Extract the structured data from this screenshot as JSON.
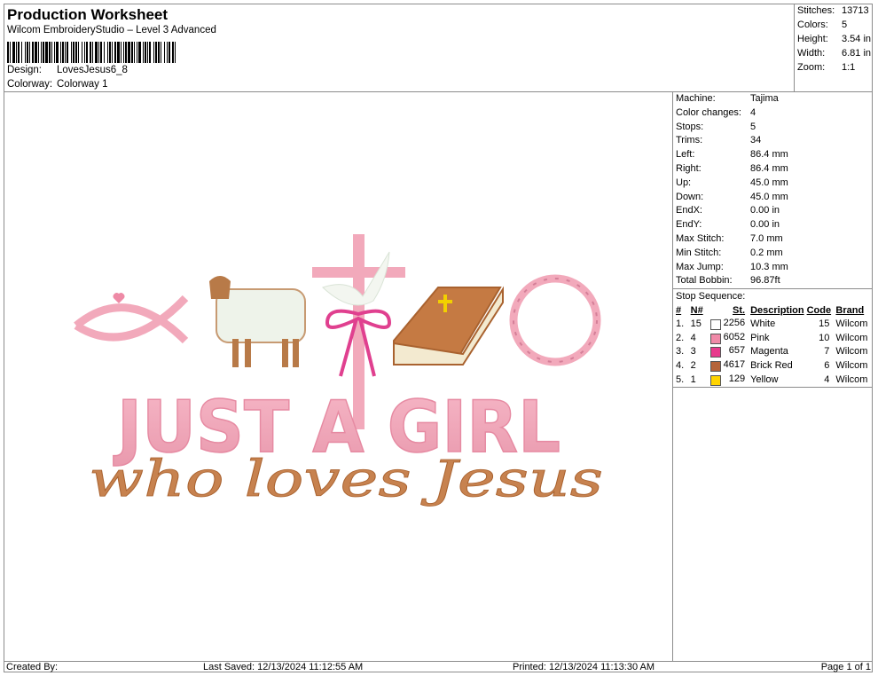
{
  "header": {
    "title": "Production Worksheet",
    "subtitle": "Wilcom EmbroideryStudio – Level 3 Advanced",
    "design_label": "Design:",
    "design_value": "LovesJesus6_8",
    "colorway_label": "Colorway:",
    "colorway_value": "Colorway 1"
  },
  "summary": {
    "stitches_label": "Stitches:",
    "stitches": "13713",
    "colors_label": "Colors:",
    "colors": "5",
    "height_label": "Height:",
    "height": "3.54 in",
    "width_label": "Width:",
    "width": "6.81 in",
    "zoom_label": "Zoom:",
    "zoom": "1:1"
  },
  "stats": [
    {
      "label": "Machine:",
      "value": "Tajima"
    },
    {
      "label": "Color changes:",
      "value": "4"
    },
    {
      "label": "Stops:",
      "value": "5"
    },
    {
      "label": "Trims:",
      "value": "34"
    },
    {
      "label": "Left:",
      "value": "86.4 mm"
    },
    {
      "label": "Right:",
      "value": "86.4 mm"
    },
    {
      "label": "Up:",
      "value": "45.0 mm"
    },
    {
      "label": "Down:",
      "value": "45.0 mm"
    },
    {
      "label": "EndX:",
      "value": "0.00 in"
    },
    {
      "label": "EndY:",
      "value": "0.00 in"
    },
    {
      "label": "Max Stitch:",
      "value": "7.0 mm"
    },
    {
      "label": "Min Stitch:",
      "value": "0.2 mm"
    },
    {
      "label": "Max Jump:",
      "value": "10.3 mm"
    },
    {
      "label": "Total Bobbin:",
      "value": "96.87ft"
    }
  ],
  "stop_sequence": {
    "title": "Stop Sequence:",
    "headers": {
      "num": "#",
      "n": "N#",
      "st": "St.",
      "desc": "Description",
      "code": "Code",
      "brand": "Brand"
    },
    "rows": [
      {
        "num": "1.",
        "n": "15",
        "color": "#ffffff",
        "st": "2256",
        "desc": "White",
        "code": "15",
        "brand": "Wilcom"
      },
      {
        "num": "2.",
        "n": "4",
        "color": "#f08aa8",
        "st": "6052",
        "desc": "Pink",
        "code": "10",
        "brand": "Wilcom"
      },
      {
        "num": "3.",
        "n": "3",
        "color": "#e83a8c",
        "st": "657",
        "desc": "Magenta",
        "code": "7",
        "brand": "Wilcom"
      },
      {
        "num": "4.",
        "n": "2",
        "color": "#b5643a",
        "st": "4617",
        "desc": "Brick Red",
        "code": "6",
        "brand": "Wilcom"
      },
      {
        "num": "5.",
        "n": "1",
        "color": "#ffd400",
        "st": "129",
        "desc": "Yellow",
        "code": "4",
        "brand": "Wilcom"
      }
    ]
  },
  "design_art": {
    "line1": "JUST A GIRL",
    "line2": "who loves Jesus"
  },
  "footer": {
    "created_by": "Created By:",
    "last_saved": "Last Saved: 12/13/2024 11:12:55 AM",
    "printed": "Printed: 12/13/2024 11:13:30 AM",
    "page": "Page 1 of 1"
  }
}
